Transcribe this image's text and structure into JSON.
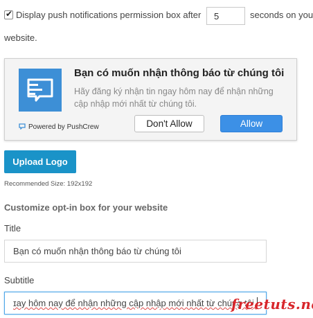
{
  "settings": {
    "checked": true,
    "text_before": "Display push notifications permission box after",
    "seconds_value": "5",
    "text_after": "seconds on you",
    "text_wrap": "website."
  },
  "preview": {
    "title": "Bạn có muốn nhận thông báo từ chúng tôi",
    "subtitle": "Hãy đăng ký nhận tin ngay hôm nay để nhận những cập nhập mới nhất từ chúng tôi.",
    "powered_by": "Powered by PushCrew",
    "dont_allow_label": "Don't Allow",
    "allow_label": "Allow",
    "logo_color": "#3d8fd6",
    "allow_color": "#3c90e6"
  },
  "upload": {
    "button_label": "Upload Logo",
    "recommended": "Recommended Size: 192x192",
    "button_color": "#1a93c8"
  },
  "customize": {
    "heading": "Customize opt-in box for your website",
    "title_label": "Title",
    "title_value": "Bạn có muốn nhận thông báo từ chúng tôi",
    "subtitle_label": "Subtitle",
    "subtitle_value": "ɪay hôm nay để nhận những cập nhập mới nhất từ chúng tôi."
  },
  "watermark": "freetuts.net"
}
